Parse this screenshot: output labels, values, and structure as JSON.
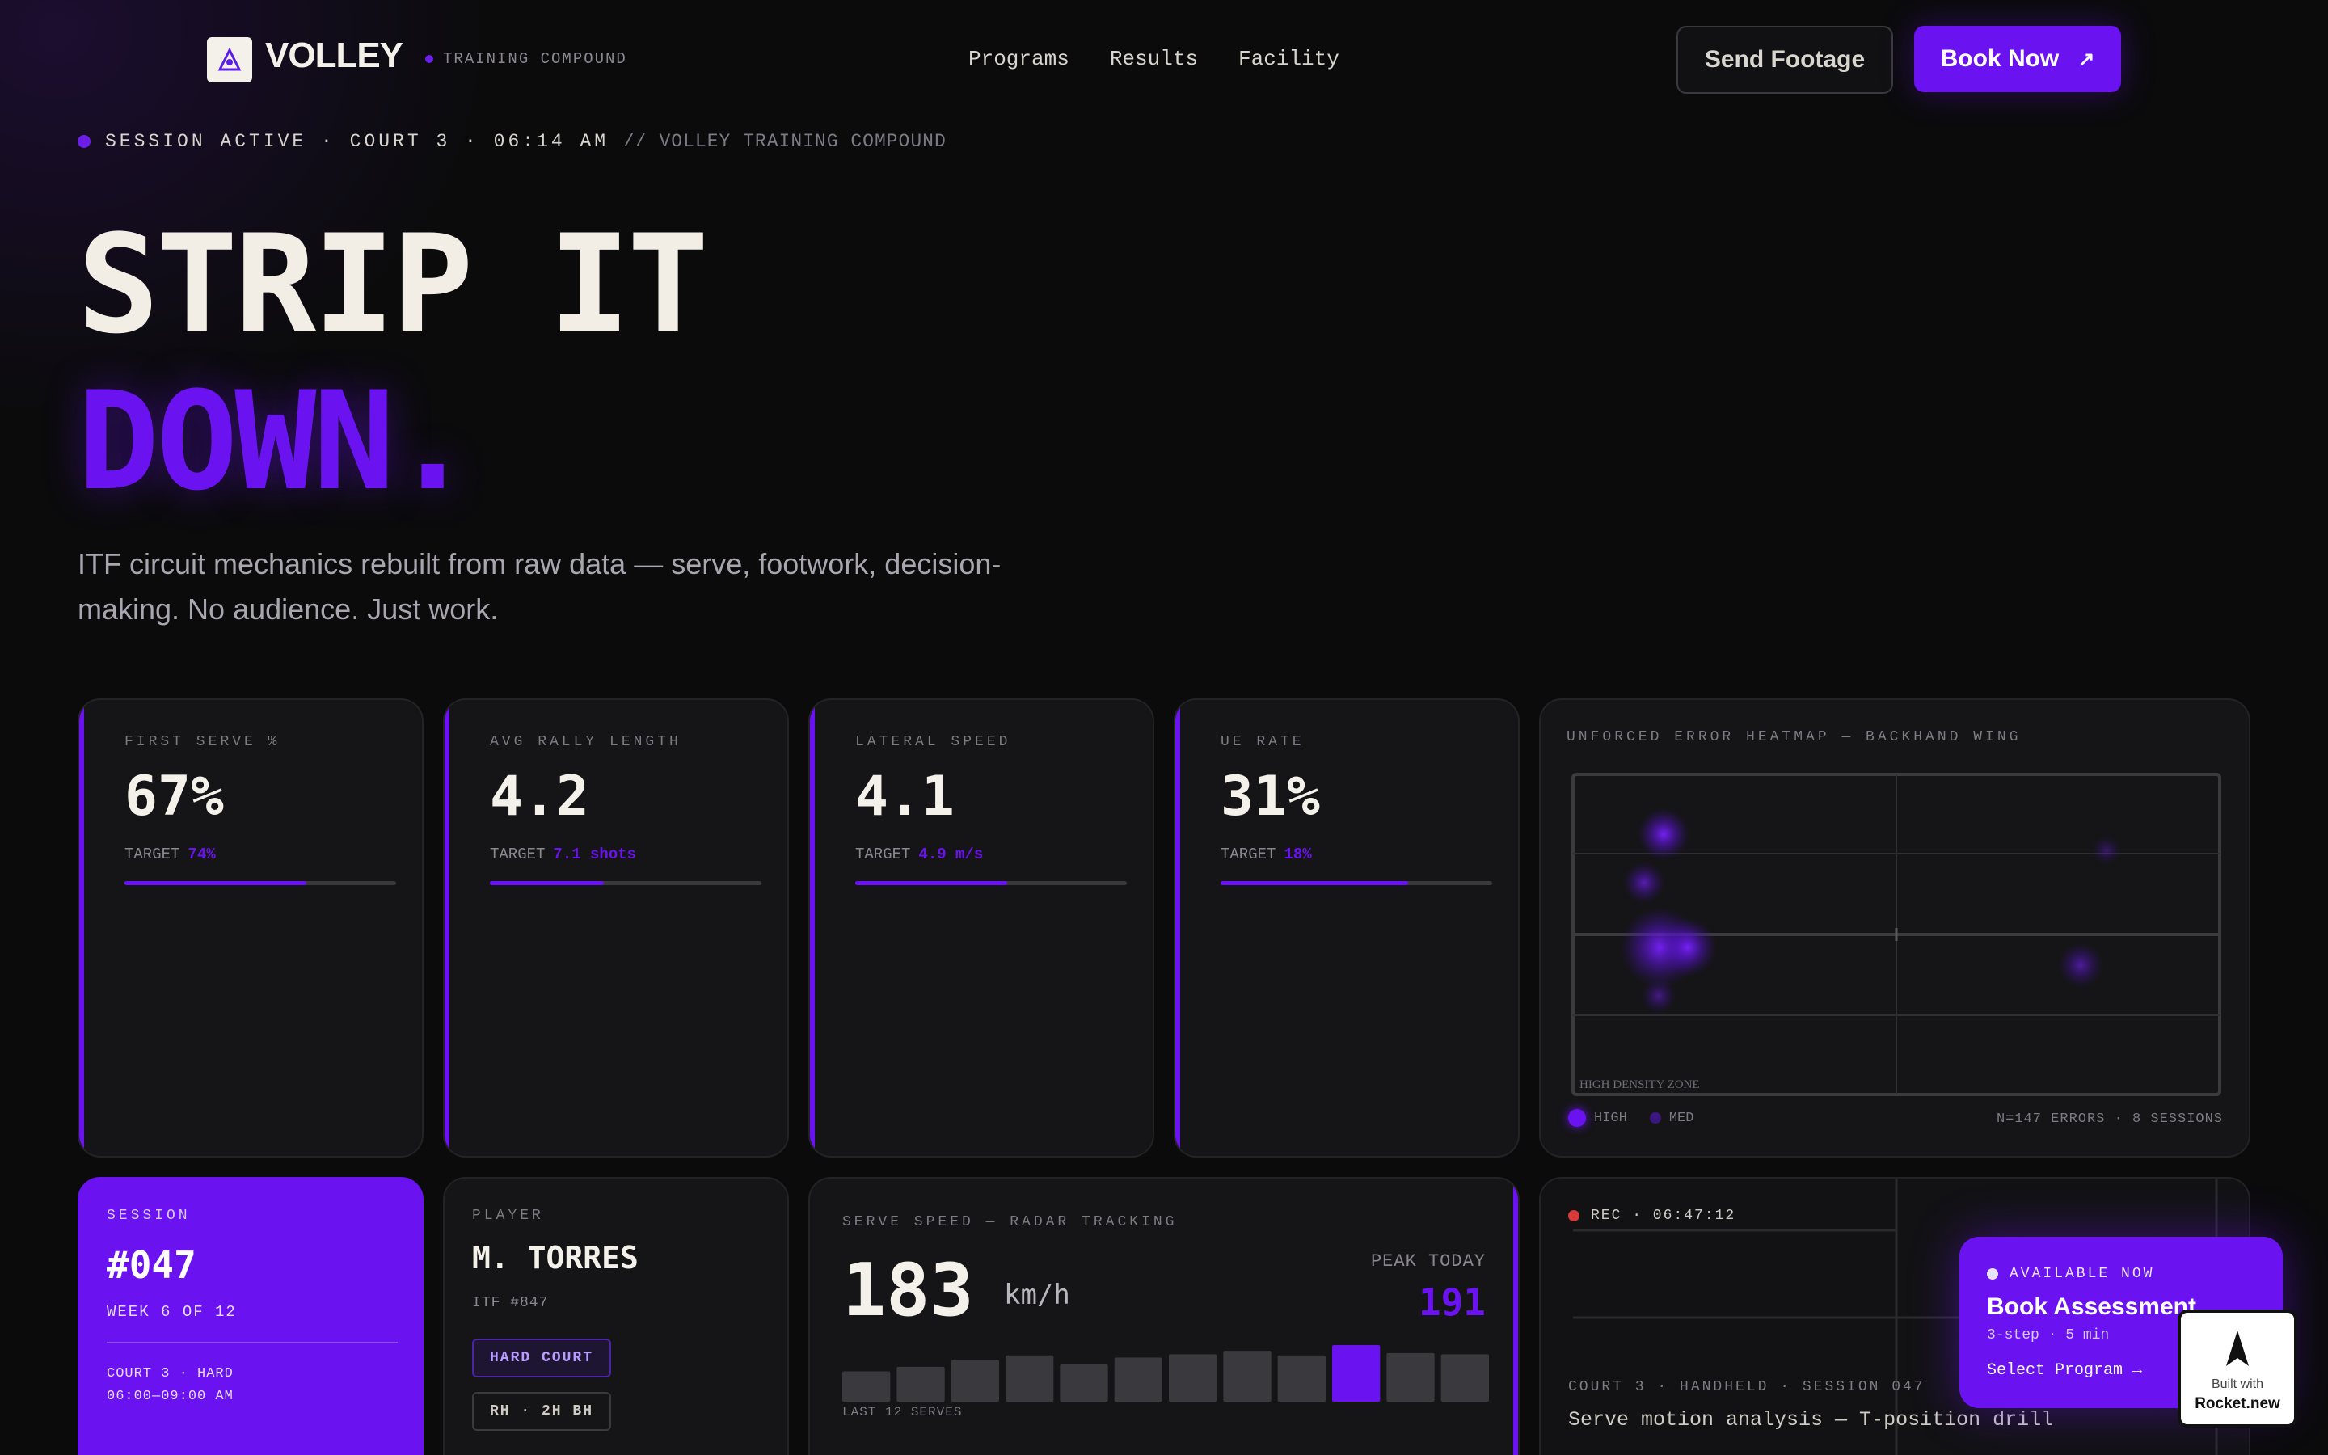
{
  "nav": {
    "brand": "VOLLEY",
    "tagline": "TRAINING COMPOUND",
    "links": [
      "Programs",
      "Results",
      "Facility"
    ],
    "send_footage": "Send Footage",
    "book_now": "Book Now",
    "book_arrow": "↗"
  },
  "status": {
    "text": "SESSION ACTIVE · COURT 3 · 06:14 AM",
    "suffix": "// VOLLEY TRAINING COMPOUND"
  },
  "hero": {
    "line1": "STRIP IT",
    "line2": "DOWN.",
    "lede": "ITF circuit mechanics rebuilt from raw data — serve, footwork, decision-making. No audience. Just work."
  },
  "kpis": [
    {
      "label": "FIRST SERVE %",
      "value": "67%",
      "target_label": "TARGET",
      "target": "74%",
      "progress": 0.67
    },
    {
      "label": "AVG RALLY LENGTH",
      "value": "4.2",
      "target_label": "TARGET",
      "target": "7.1 shots",
      "progress": 0.42
    },
    {
      "label": "LATERAL SPEED",
      "value": "4.1",
      "target_label": "TARGET",
      "target": "4.9 m/s",
      "progress": 0.56
    },
    {
      "label": "UE RATE",
      "value": "31%",
      "target_label": "TARGET",
      "target": "18%",
      "progress": 0.69
    }
  ],
  "heatmap": {
    "title": "UNFORCED ERROR HEATMAP — BACKHAND WING",
    "zone_label": "HIGH DENSITY ZONE",
    "legend_high": "HIGH",
    "legend_med": "MED",
    "meta": "N=147 ERRORS · 8 SESSIONS"
  },
  "session": {
    "label": "SESSION",
    "number": "#047",
    "week": "WEEK 6 OF 12",
    "court": "COURT 3 · HARD",
    "time": "06:00—09:00 AM"
  },
  "player": {
    "label": "PLAYER",
    "name": "M. TORRES",
    "id": "ITF #847",
    "tag1": "HARD COURT",
    "tag2": "RH · 2H BH"
  },
  "serve": {
    "title": "SERVE SPEED — RADAR TRACKING",
    "value": "183",
    "unit": "km/h",
    "peak_label": "PEAK TODAY",
    "peak": "191",
    "caption": "LAST 12 SERVES"
  },
  "chart_data": {
    "type": "bar",
    "title": "",
    "categories": [
      "1",
      "2",
      "3",
      "4",
      "5",
      "6",
      "7",
      "8",
      "9",
      "10",
      "11",
      "12"
    ],
    "series": [
      {
        "values": [
          168,
          172,
          178,
          182,
          174,
          180,
          183,
          186,
          182,
          191,
          184,
          183
        ]
      }
    ],
    "highlight_index": 9,
    "xlabel": "LAST 12 SERVES",
    "ylabel": ""
  },
  "video": {
    "rec": "REC · 06:47:12",
    "meta": "COURT 3 · HANDHELD · SESSION 047",
    "caption": "Serve motion analysis — T-position drill"
  },
  "cta": {
    "availability": "AVAILABLE NOW",
    "title": "Book Assessment",
    "sub": "3-step · 5 min",
    "action": "Select Program",
    "arrow": "→"
  },
  "badge": {
    "line1": "Built with",
    "line2": "Rocket.new"
  },
  "colors": {
    "accent": "#6a12f0",
    "background": "#0b0b0c",
    "card": "#151517",
    "rec": "#d93a3a"
  }
}
